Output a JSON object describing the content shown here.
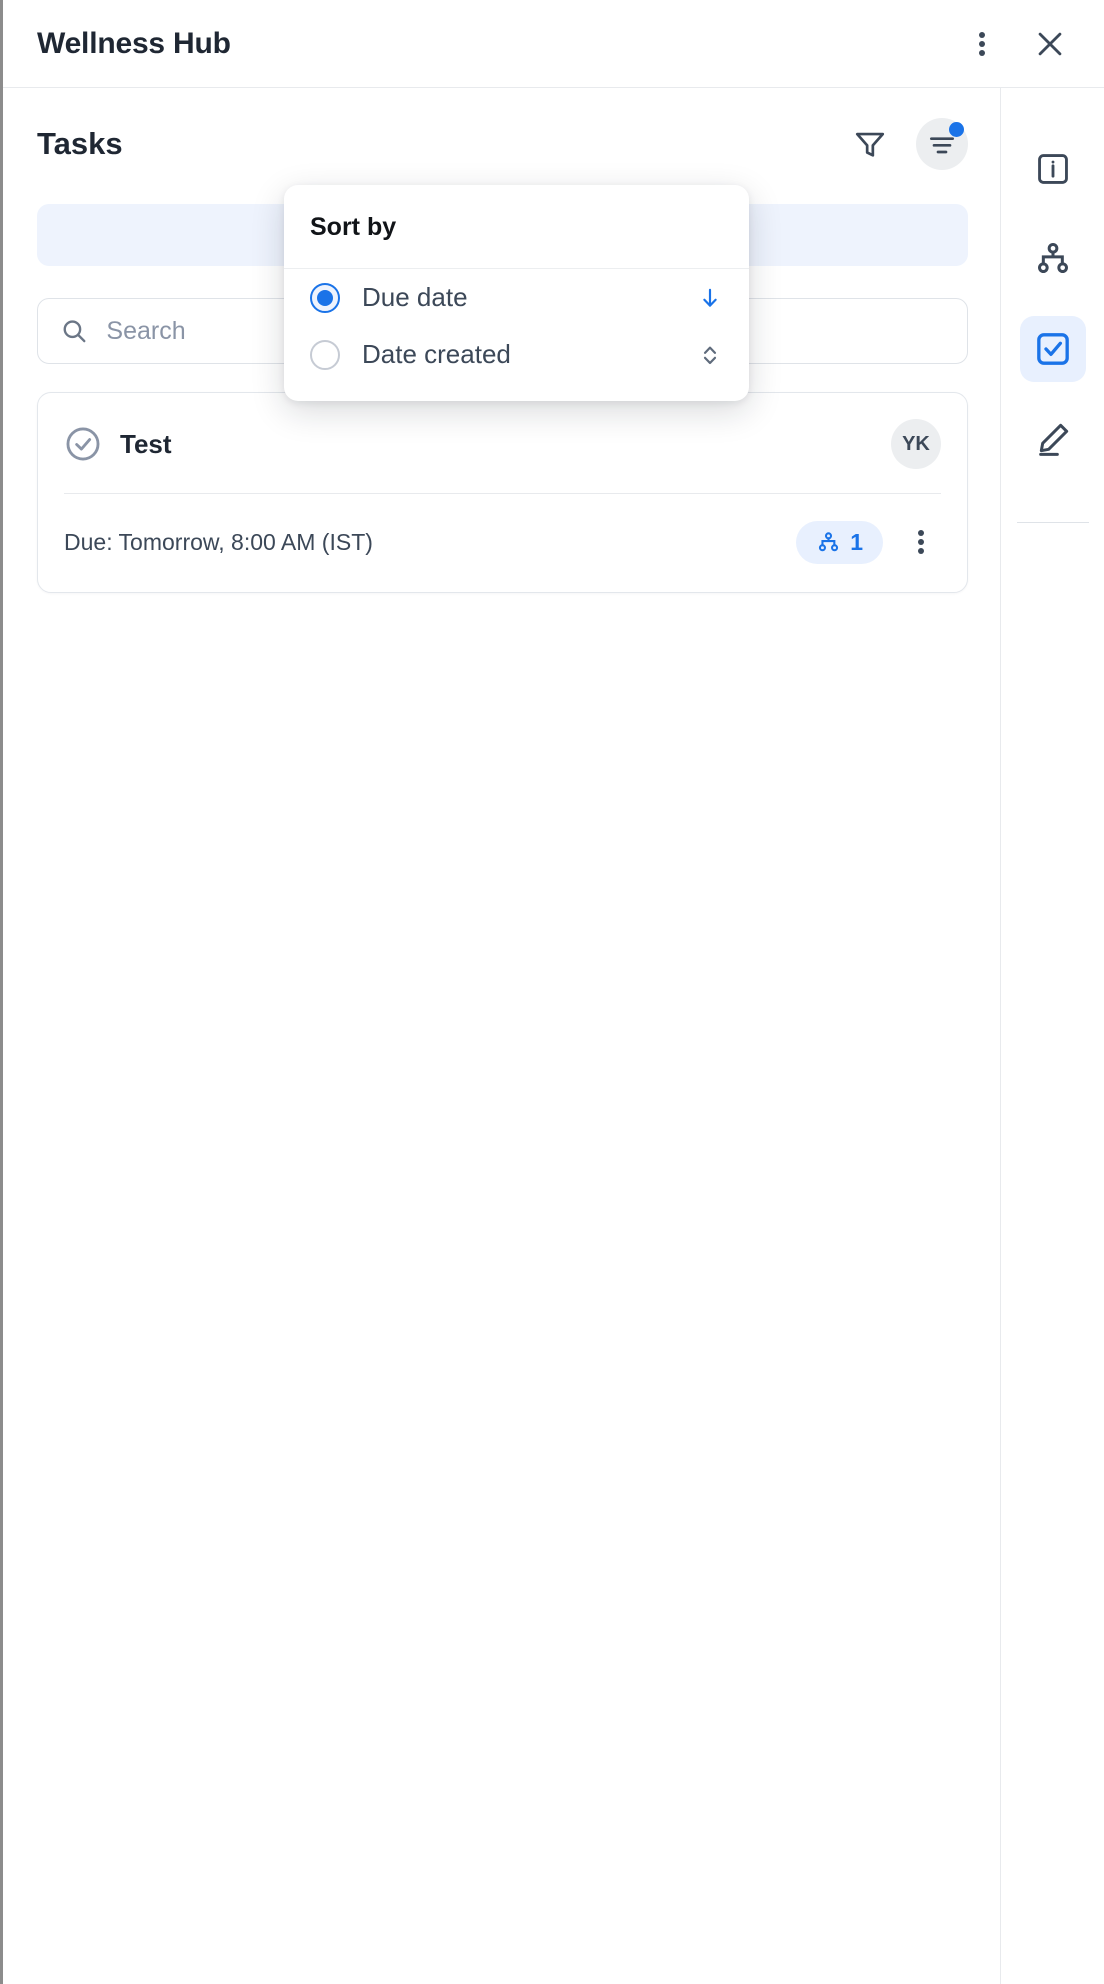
{
  "window": {
    "title": "Wellness Hub",
    "more_icon": "kebab-menu-icon",
    "close_icon": "close-icon"
  },
  "panel": {
    "title": "Tasks",
    "filter_icon": "filter-funnel-icon",
    "sort_icon": "sort-lines-icon",
    "sort_badge": "notification-dot"
  },
  "search": {
    "placeholder": "Search",
    "value": "",
    "icon": "search-icon"
  },
  "sort_menu": {
    "heading": "Sort by",
    "options": [
      {
        "label": "Due date",
        "selected": true,
        "direction_icon": "arrow-down-icon"
      },
      {
        "label": "Date created",
        "selected": false,
        "direction_icon": "chevron-up-down-icon"
      }
    ]
  },
  "task": {
    "status_icon": "check-circle-icon",
    "name": "Test",
    "avatar_initials": "YK",
    "due_text": "Due: Tomorrow, 8:00 AM (IST)",
    "subtask_count": "1",
    "subtask_icon": "branch-icon",
    "more_icon": "kebab-menu-icon"
  },
  "rail": {
    "items": [
      {
        "name": "info-icon",
        "active": false
      },
      {
        "name": "branch-icon",
        "active": false
      },
      {
        "name": "tasks-checkbox-icon",
        "active": true
      },
      {
        "name": "pen-edit-icon",
        "active": false
      }
    ]
  },
  "colors": {
    "accent": "#1a73e8",
    "text": "#1f2733",
    "muted": "#3c4858",
    "border": "#e8eaed",
    "chip_bg": "#e8f0fe"
  }
}
